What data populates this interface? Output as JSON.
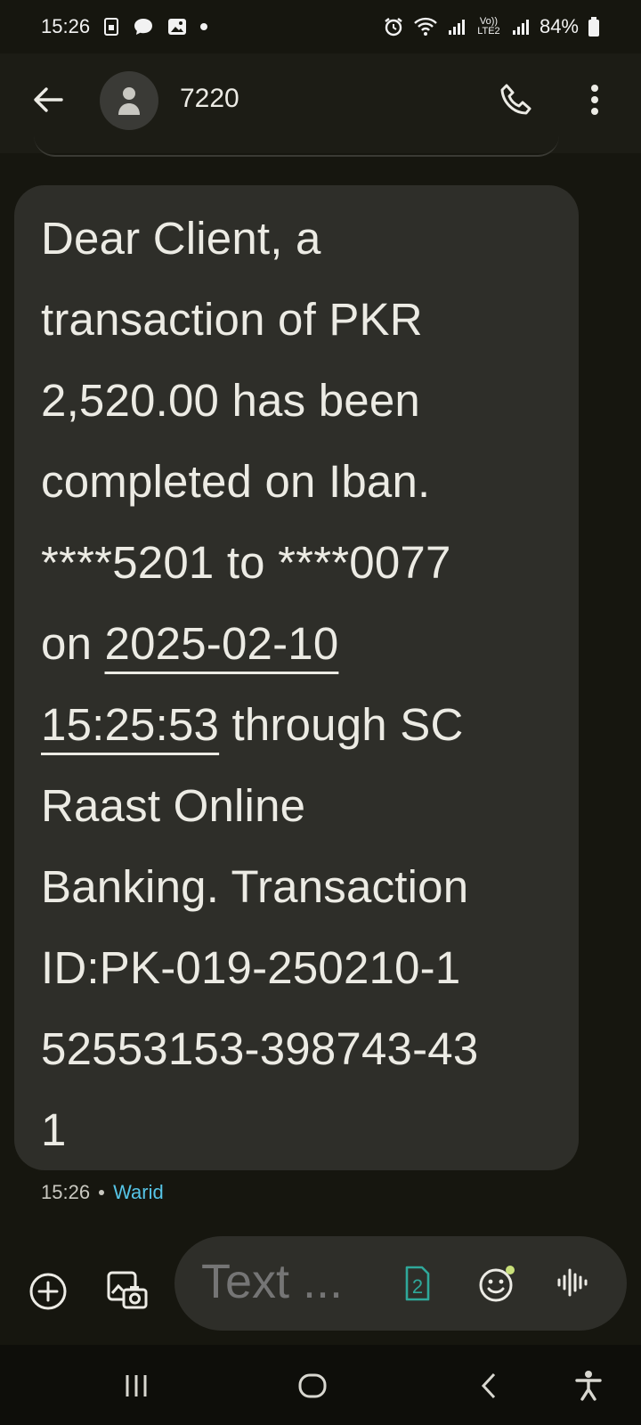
{
  "status_bar": {
    "time": "15:26",
    "battery_percent": "84%",
    "network_label": "Vo)) LTE2"
  },
  "header": {
    "contact_name": "7220"
  },
  "message": {
    "lines": [
      "Dear Client, a",
      "transaction of PKR",
      "2,520.00 has been",
      "completed on Iban.",
      "****5201 to ****0077",
      "on ",
      "2025-02-10",
      "15:25:53",
      " through SC",
      "Raast Online",
      "Banking. Transaction",
      "ID:PK-019-250210-1",
      "52553153-398743-43",
      "1"
    ],
    "timestamp": "15:26",
    "carrier": "Warid"
  },
  "compose": {
    "placeholder": "Text ...",
    "sim_slot": "2"
  },
  "colors": {
    "background": "#16160f",
    "bubble": "#2e2e29",
    "carrier_accent": "#56c4e6",
    "sim_accent": "#2fa89a",
    "emoji_dot": "#c9e07a"
  }
}
